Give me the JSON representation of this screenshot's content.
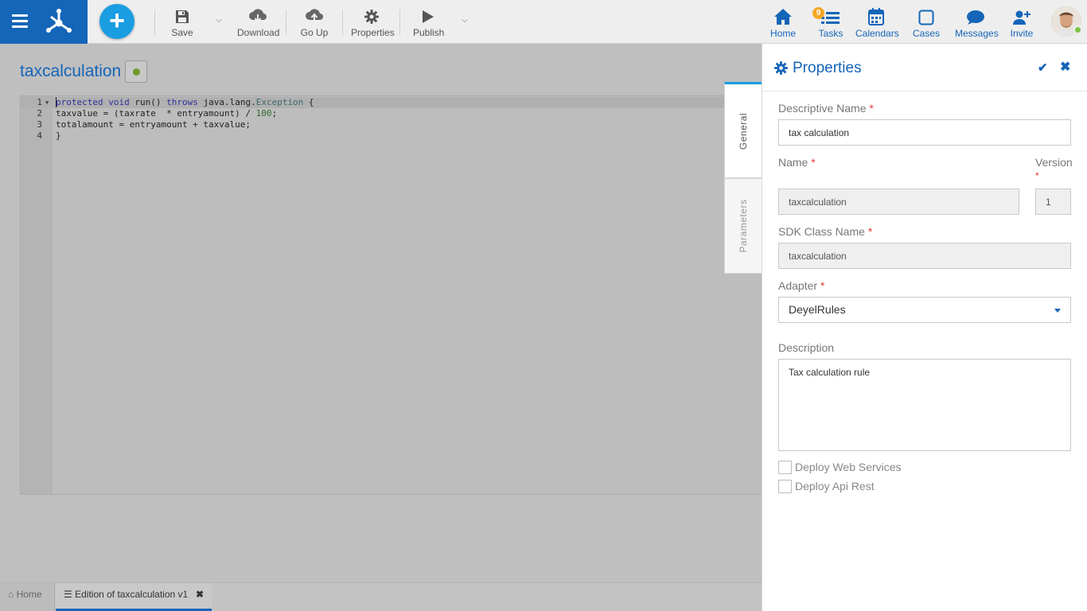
{
  "toolbar": {
    "save": "Save",
    "download": "Download",
    "go_up": "Go Up",
    "properties": "Properties",
    "publish": "Publish"
  },
  "nav": {
    "home": "Home",
    "tasks": "Tasks",
    "tasks_badge": "9",
    "calendars": "Calendars",
    "cases": "Cases",
    "messages": "Messages",
    "invite": "Invite"
  },
  "document": {
    "title": "taxcalculation"
  },
  "editor": {
    "lines": [
      {
        "num": "1",
        "code": "protected void run() throws java.lang.Exception {"
      },
      {
        "num": "2",
        "code": "taxvalue = (taxrate  * entryamount) / 100;"
      },
      {
        "num": "3",
        "code": "totalamount = entryamount + taxvalue;"
      },
      {
        "num": "4",
        "code": "}"
      }
    ]
  },
  "side_tabs": {
    "general": "General",
    "parameters": "Parameters"
  },
  "properties_panel": {
    "title": "Properties",
    "descriptive_name_label": "Descriptive Name",
    "descriptive_name_value": "tax calculation",
    "name_label": "Name",
    "name_value": "taxcalculation",
    "version_label": "Version",
    "version_value": "1",
    "sdk_class_name_label": "SDK Class Name",
    "sdk_class_name_value": "taxcalculation",
    "adapter_label": "Adapter",
    "adapter_value": "DeyelRules",
    "description_label": "Description",
    "description_value": "Tax calculation rule",
    "deploy_web_services": "Deploy Web Services",
    "deploy_api_rest": "Deploy Api Rest",
    "required_mark": "*"
  },
  "bottom_tabs": {
    "home": "Home",
    "edition": "Edition of taxcalculation v1"
  },
  "colors": {
    "brand": "#1565b8",
    "accent": "#1a9de1",
    "badge": "#f5a623",
    "required": "#e53935"
  }
}
